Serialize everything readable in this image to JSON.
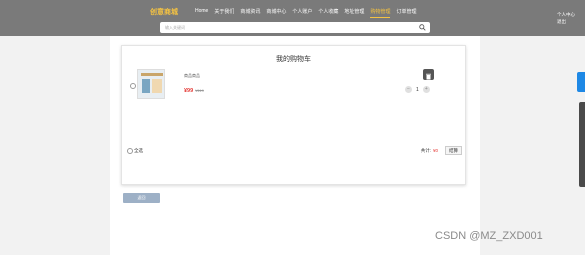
{
  "header": {
    "brand": "创意商城",
    "nav": [
      "Home",
      "关于我们",
      "商城资讯",
      "商城中心",
      "个人账户",
      "个人收藏",
      "地址管理",
      "购物管理",
      "订单管理"
    ],
    "active_index": 7,
    "user_menu": [
      "个人中心",
      "退出"
    ],
    "search_placeholder": "输入关键词"
  },
  "cart": {
    "title": "我的购物车",
    "item": {
      "name": "商品商品",
      "price": "¥99",
      "old_price": "¥119",
      "quantity": "1"
    },
    "select_all": "全选",
    "total_label": "共计:",
    "total_value": "¥0",
    "checkout": "结算"
  },
  "back_button": "返回",
  "watermark": "CSDN @MZ_ZXD001",
  "colors": {
    "header_bg": "#7a7a7a",
    "accent": "#f5c342",
    "price": "#e53935"
  }
}
